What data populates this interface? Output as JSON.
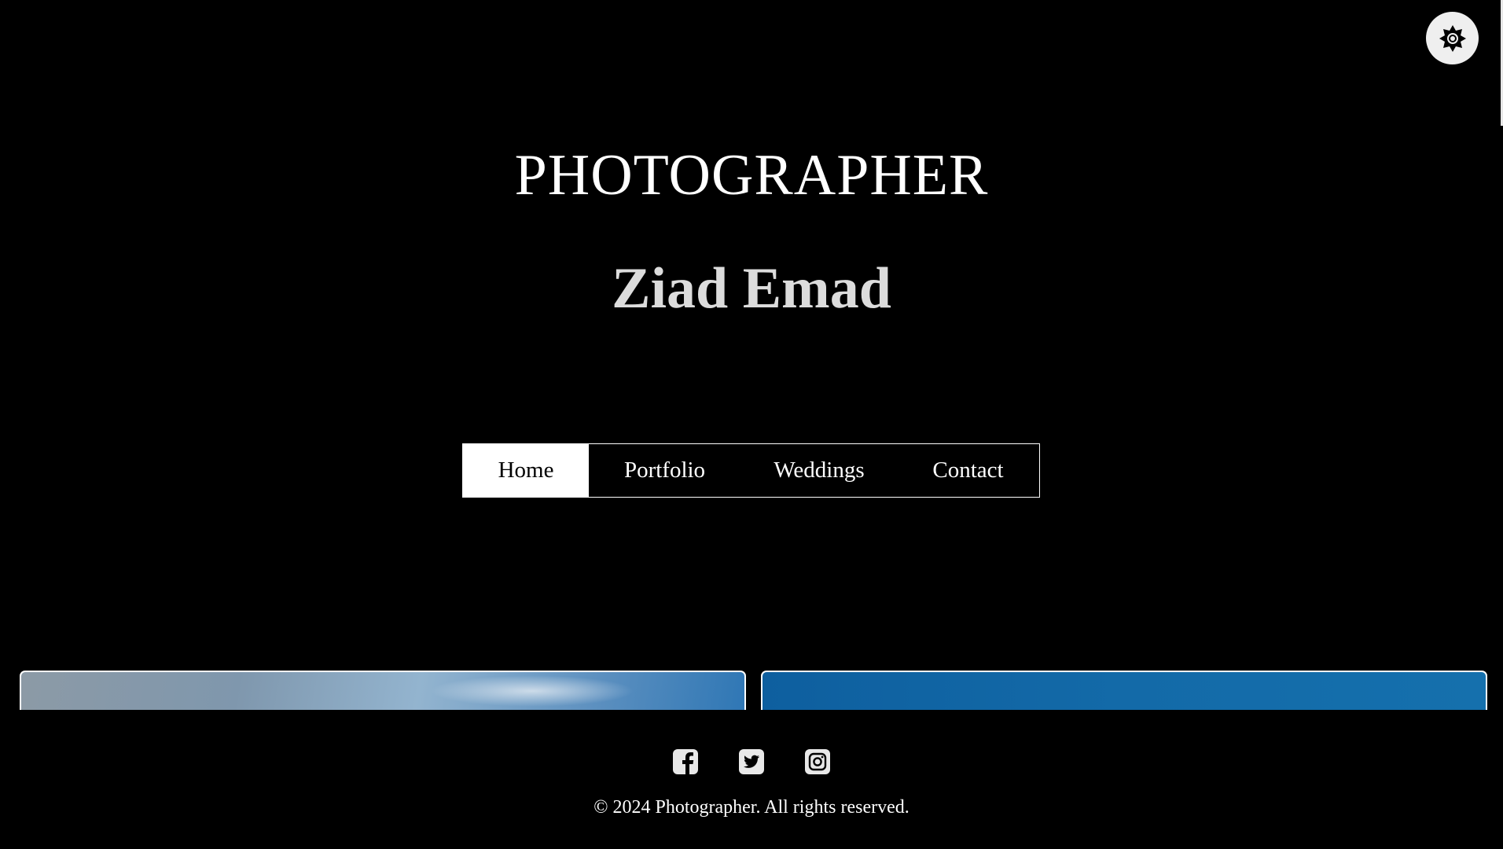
{
  "header": {
    "title": "PHOTOGRAPHER",
    "name": "Ziad Emad"
  },
  "nav": {
    "items": [
      {
        "label": "Home",
        "active": true
      },
      {
        "label": "Portfolio",
        "active": false
      },
      {
        "label": "Weddings",
        "active": false
      },
      {
        "label": "Contact",
        "active": false
      }
    ]
  },
  "theme_toggle": {
    "icon": "sun-gear-icon"
  },
  "gallery": {
    "cards": [
      {
        "icon": "sky-photo"
      },
      {
        "icon": "blue-photo"
      }
    ]
  },
  "footer": {
    "social": [
      {
        "icon": "facebook-icon"
      },
      {
        "icon": "twitter-icon"
      },
      {
        "icon": "instagram-icon"
      }
    ],
    "copyright": "© 2024 Photographer. All rights reserved."
  },
  "colors": {
    "background": "#000000",
    "text": "#ffffff",
    "name_text": "#dcdcdc",
    "toggle_bg": "#efefef"
  }
}
